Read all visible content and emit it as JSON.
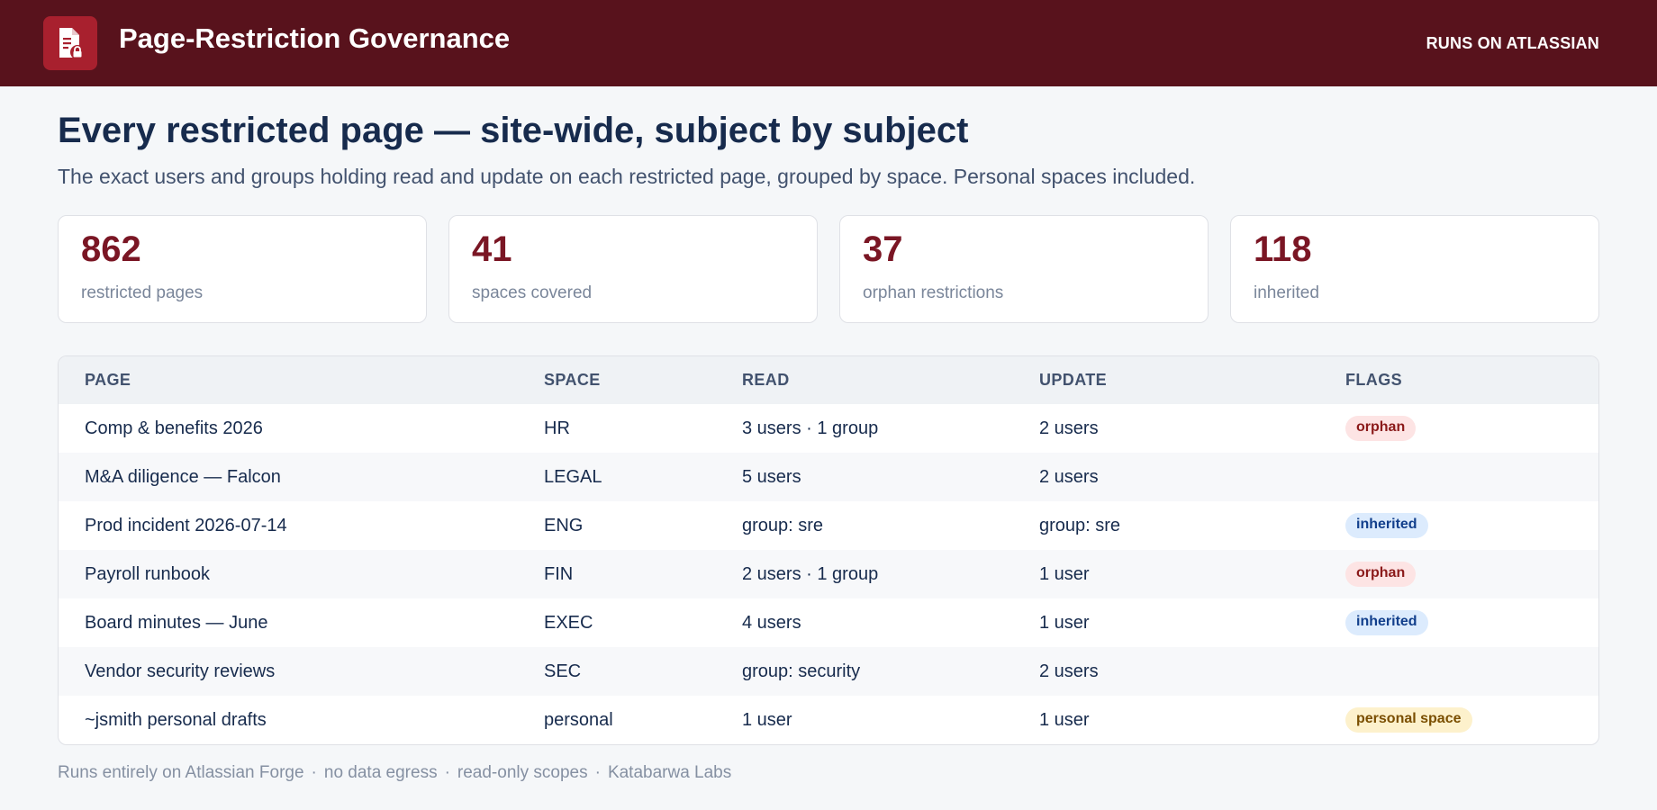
{
  "header": {
    "app_title": "Page-Restriction Governance",
    "right_label": "RUNS ON ATLASSIAN",
    "logo_icon": "page-lock-icon"
  },
  "main": {
    "title": "Every restricted page — site-wide, subject by subject",
    "subtitle": "The exact users and groups holding read and update on each restricted page, grouped by space. Personal spaces included."
  },
  "stats": [
    {
      "value": "862",
      "label": "restricted pages"
    },
    {
      "value": "41",
      "label": "spaces covered"
    },
    {
      "value": "37",
      "label": "orphan restrictions"
    },
    {
      "value": "118",
      "label": "inherited"
    }
  ],
  "table": {
    "columns": [
      "PAGE",
      "SPACE",
      "READ",
      "UPDATE",
      "FLAGS"
    ],
    "rows": [
      {
        "page": "Comp & benefits 2026",
        "space": "HR",
        "read": "3 users · 1 group",
        "update": "2 users",
        "flag": "orphan"
      },
      {
        "page": "M&A diligence — Falcon",
        "space": "LEGAL",
        "read": "5 users",
        "update": "2 users",
        "flag": ""
      },
      {
        "page": "Prod incident 2026-07-14",
        "space": "ENG",
        "read": "group: sre",
        "update": "group: sre",
        "flag": "inherited"
      },
      {
        "page": "Payroll runbook",
        "space": "FIN",
        "read": "2 users · 1 group",
        "update": "1 user",
        "flag": "orphan"
      },
      {
        "page": "Board minutes — June",
        "space": "EXEC",
        "read": "4 users",
        "update": "1 user",
        "flag": "inherited"
      },
      {
        "page": "Vendor security reviews",
        "space": "SEC",
        "read": "group: security",
        "update": "2 users",
        "flag": ""
      },
      {
        "page": "~jsmith personal drafts",
        "space": "personal",
        "read": "1 user",
        "update": "1 user",
        "flag": "personal space"
      }
    ]
  },
  "footer": {
    "items": [
      "Runs entirely on Atlassian Forge",
      "no data egress",
      "read-only scopes",
      "Katabarwa Labs"
    ],
    "separator": "·"
  },
  "colors": {
    "topbar": "#58121c",
    "logo_bg": "#a8202e",
    "accent": "#7a1624",
    "orphan_bg": "#fde4e4",
    "inherited_bg": "#dcebfd",
    "personal_bg": "#fdf1cc"
  }
}
